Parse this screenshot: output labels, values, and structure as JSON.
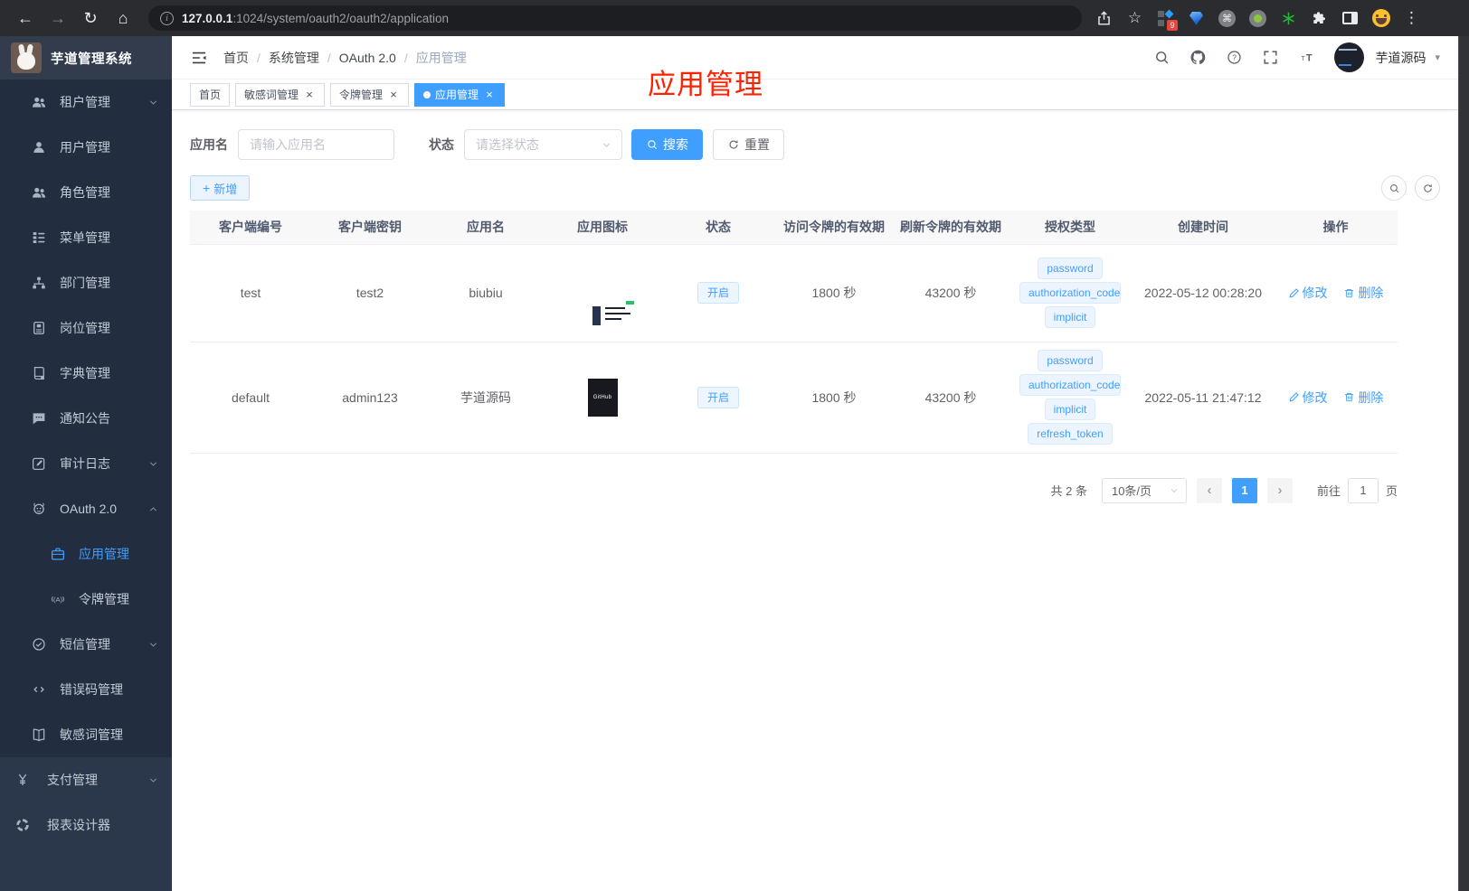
{
  "browser": {
    "url_host": "127.0.0.1",
    "url_rest": ":1024/system/oauth2/oauth2/application",
    "extension_badge": "9"
  },
  "icons": {
    "back": "←",
    "forward": "→",
    "reload": "↻",
    "home": "⌂",
    "star": "☆",
    "command": "⌘",
    "menu_dots": "⋮",
    "info": "i",
    "caret_down": "▾",
    "close": "×",
    "plus": "+",
    "prev": "‹",
    "next": "›",
    "slash": "/"
  },
  "overlay": {
    "text": "应用管理"
  },
  "sidebar": {
    "logo_title": "芋道管理系统",
    "items": [
      {
        "label": "租户管理"
      },
      {
        "label": "用户管理"
      },
      {
        "label": "角色管理"
      },
      {
        "label": "菜单管理"
      },
      {
        "label": "部门管理"
      },
      {
        "label": "岗位管理"
      },
      {
        "label": "字典管理"
      },
      {
        "label": "通知公告"
      },
      {
        "label": "审计日志"
      },
      {
        "label": "OAuth 2.0"
      },
      {
        "label": "应用管理"
      },
      {
        "label": "令牌管理"
      },
      {
        "label": "短信管理"
      },
      {
        "label": "错误码管理"
      },
      {
        "label": "敏感词管理"
      },
      {
        "label": "支付管理"
      },
      {
        "label": "报表设计器"
      }
    ]
  },
  "header": {
    "breadcrumb": [
      "首页",
      "系统管理",
      "OAuth 2.0",
      "应用管理"
    ],
    "user_name": "芋道源码"
  },
  "tabs": [
    {
      "label": "首页"
    },
    {
      "label": "敏感词管理"
    },
    {
      "label": "令牌管理"
    },
    {
      "label": "应用管理"
    }
  ],
  "filter": {
    "name_label": "应用名",
    "name_placeholder": "请输入应用名",
    "status_label": "状态",
    "status_placeholder": "请选择状态",
    "search_label": "搜索",
    "reset_label": "重置"
  },
  "toolbar": {
    "add_label": "新增"
  },
  "table": {
    "headers": [
      "客户端编号",
      "客户端密钥",
      "应用名",
      "应用图标",
      "状态",
      "访问令牌的有效期",
      "刷新令牌的有效期",
      "授权类型",
      "创建时间",
      "操作"
    ],
    "rows": [
      {
        "client_id": "test",
        "client_secret": "test2",
        "app_name": "biubiu",
        "status": "开启",
        "access_ttl": "1800 秒",
        "refresh_ttl": "43200 秒",
        "grant_types": [
          "password",
          "authorization_code",
          "implicit"
        ],
        "created_at": "2022-05-12 00:28:20",
        "edit_label": "修改",
        "delete_label": "删除"
      },
      {
        "client_id": "default",
        "client_secret": "admin123",
        "app_name": "芋道源码",
        "icon_text": "GitHub",
        "status": "开启",
        "access_ttl": "1800 秒",
        "refresh_ttl": "43200 秒",
        "grant_types": [
          "password",
          "authorization_code",
          "implicit",
          "refresh_token"
        ],
        "created_at": "2022-05-11 21:47:12",
        "edit_label": "修改",
        "delete_label": "删除"
      }
    ]
  },
  "pagination": {
    "total_text": "共 2 条",
    "page_size": "10条/页",
    "current_page": "1",
    "goto_label": "前往",
    "goto_value": "1",
    "page_suffix": "页"
  },
  "colors": {
    "primary": "#409eff",
    "annotation": "#ff2200",
    "sidebar_bg": "#222d40"
  }
}
